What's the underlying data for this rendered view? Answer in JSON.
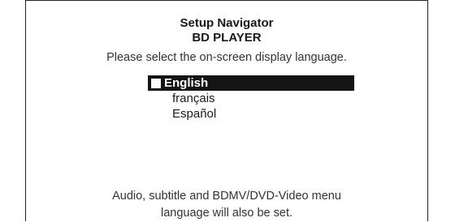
{
  "header": {
    "title": "Setup Navigator",
    "subtitle": "BD PLAYER",
    "instruction": "Please select the on-screen display language."
  },
  "languages": {
    "selected_index": 0,
    "items": [
      {
        "label": "English"
      },
      {
        "label": "français"
      },
      {
        "label": "Español"
      }
    ]
  },
  "footer": {
    "note_line1": "Audio, subtitle and BDMV/DVD-Video menu",
    "note_line2": "language will also be set."
  },
  "colors": {
    "highlight_background": "#141414",
    "highlight_text": "#ffffff",
    "text": "#1a1a1a",
    "background": "#ffffff"
  }
}
